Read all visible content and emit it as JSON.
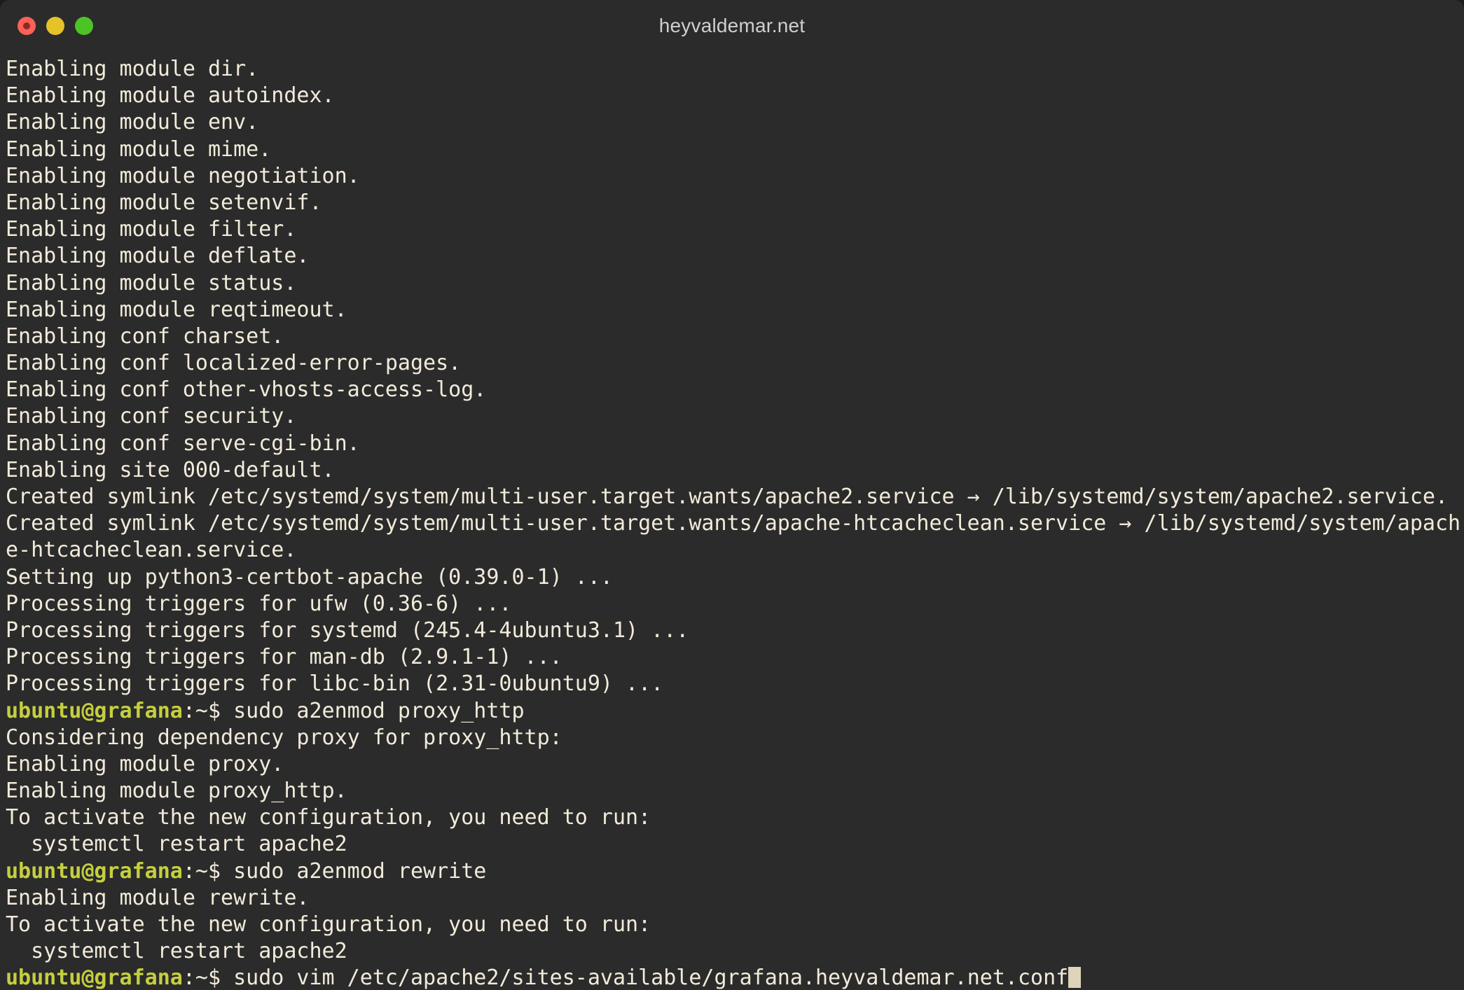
{
  "window": {
    "title": "heyvaldemar.net",
    "controls": [
      {
        "name": "close",
        "color": "#ff6058"
      },
      {
        "name": "minimize",
        "color": "#e6c229"
      },
      {
        "name": "maximize",
        "color": "#4cc425"
      }
    ]
  },
  "terminal": {
    "colors": {
      "background": "#2b2b2b",
      "foreground": "#f2ebda",
      "prompt": "#c5cf3f",
      "cursor": "#ded4ba"
    },
    "prompt_text": "ubuntu@grafana:~$ ",
    "lines": [
      {
        "type": "output",
        "text": "Enabling module dir."
      },
      {
        "type": "output",
        "text": "Enabling module autoindex."
      },
      {
        "type": "output",
        "text": "Enabling module env."
      },
      {
        "type": "output",
        "text": "Enabling module mime."
      },
      {
        "type": "output",
        "text": "Enabling module negotiation."
      },
      {
        "type": "output",
        "text": "Enabling module setenvif."
      },
      {
        "type": "output",
        "text": "Enabling module filter."
      },
      {
        "type": "output",
        "text": "Enabling module deflate."
      },
      {
        "type": "output",
        "text": "Enabling module status."
      },
      {
        "type": "output",
        "text": "Enabling module reqtimeout."
      },
      {
        "type": "output",
        "text": "Enabling conf charset."
      },
      {
        "type": "output",
        "text": "Enabling conf localized-error-pages."
      },
      {
        "type": "output",
        "text": "Enabling conf other-vhosts-access-log."
      },
      {
        "type": "output",
        "text": "Enabling conf security."
      },
      {
        "type": "output",
        "text": "Enabling conf serve-cgi-bin."
      },
      {
        "type": "output",
        "text": "Enabling site 000-default."
      },
      {
        "type": "output",
        "text": "Created symlink /etc/systemd/system/multi-user.target.wants/apache2.service → /lib/systemd/system/apache2.service."
      },
      {
        "type": "output",
        "text": "Created symlink /etc/systemd/system/multi-user.target.wants/apache-htcacheclean.service → /lib/systemd/system/apach"
      },
      {
        "type": "output",
        "text": "e-htcacheclean.service."
      },
      {
        "type": "output",
        "text": "Setting up python3-certbot-apache (0.39.0-1) ..."
      },
      {
        "type": "output",
        "text": "Processing triggers for ufw (0.36-6) ..."
      },
      {
        "type": "output",
        "text": "Processing triggers for systemd (245.4-4ubuntu3.1) ..."
      },
      {
        "type": "output",
        "text": "Processing triggers for man-db (2.9.1-1) ..."
      },
      {
        "type": "output",
        "text": "Processing triggers for libc-bin (2.31-0ubuntu9) ..."
      },
      {
        "type": "command",
        "prompt": "ubuntu@grafana",
        "promptTail": ":~$ ",
        "command": "sudo a2enmod proxy_http"
      },
      {
        "type": "output",
        "text": "Considering dependency proxy for proxy_http:"
      },
      {
        "type": "output",
        "text": "Enabling module proxy."
      },
      {
        "type": "output",
        "text": "Enabling module proxy_http."
      },
      {
        "type": "output",
        "text": "To activate the new configuration, you need to run:"
      },
      {
        "type": "output",
        "text": "  systemctl restart apache2"
      },
      {
        "type": "command",
        "prompt": "ubuntu@grafana",
        "promptTail": ":~$ ",
        "command": "sudo a2enmod rewrite"
      },
      {
        "type": "output",
        "text": "Enabling module rewrite."
      },
      {
        "type": "output",
        "text": "To activate the new configuration, you need to run:"
      },
      {
        "type": "output",
        "text": "  systemctl restart apache2"
      },
      {
        "type": "command",
        "prompt": "ubuntu@grafana",
        "promptTail": ":~$ ",
        "command": "sudo vim /etc/apache2/sites-available/grafana.heyvaldemar.net.conf",
        "cursor": true
      }
    ]
  }
}
